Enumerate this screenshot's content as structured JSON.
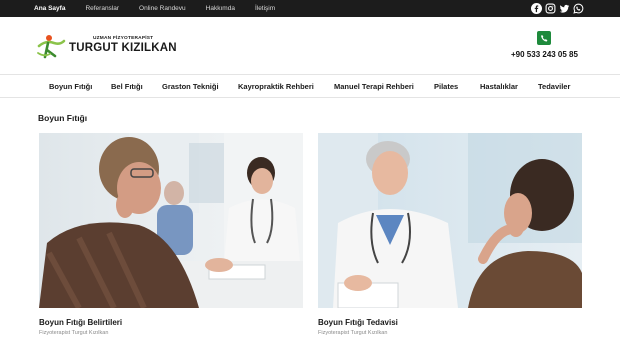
{
  "topnav": {
    "items": [
      {
        "label": "Ana Sayfa"
      },
      {
        "label": "Referanslar"
      },
      {
        "label": "Online Randevu"
      },
      {
        "label": "Hakkımda"
      },
      {
        "label": "İletişim"
      }
    ]
  },
  "socials": [
    "facebook-icon",
    "instagram-icon",
    "twitter-icon",
    "whatsapp-icon"
  ],
  "brand": {
    "subtitle": "UZMAN FİZYOTERAPİST",
    "name": "TURGUT KIZILKAN",
    "logo_colors": [
      "#e8521f",
      "#8bc34a",
      "#3c8b2f"
    ]
  },
  "contact": {
    "phone": "+90 533 243 05 85",
    "icon": "phone-icon",
    "icon_color": "#1e8a3c"
  },
  "mainnav": {
    "items": [
      {
        "label": "Boyun Fıtığı"
      },
      {
        "label": "Bel Fıtığı"
      },
      {
        "label": "Graston Tekniği"
      },
      {
        "label": "Kayropraktik Rehberi"
      },
      {
        "label": "Manuel Terapi Rehberi"
      },
      {
        "label": "Pilates"
      },
      {
        "label": "Hastalıklar"
      },
      {
        "label": "Tedaviler"
      }
    ]
  },
  "page": {
    "title": "Boyun Fıtığı"
  },
  "cards": [
    {
      "title": "Boyun Fıtığı Belirtileri",
      "author": "Fizyoterapist Turgut Kızılkan"
    },
    {
      "title": "Boyun Fıtığı Tedavisi",
      "author": "Fizyoterapist Turgut Kızılkan"
    }
  ]
}
